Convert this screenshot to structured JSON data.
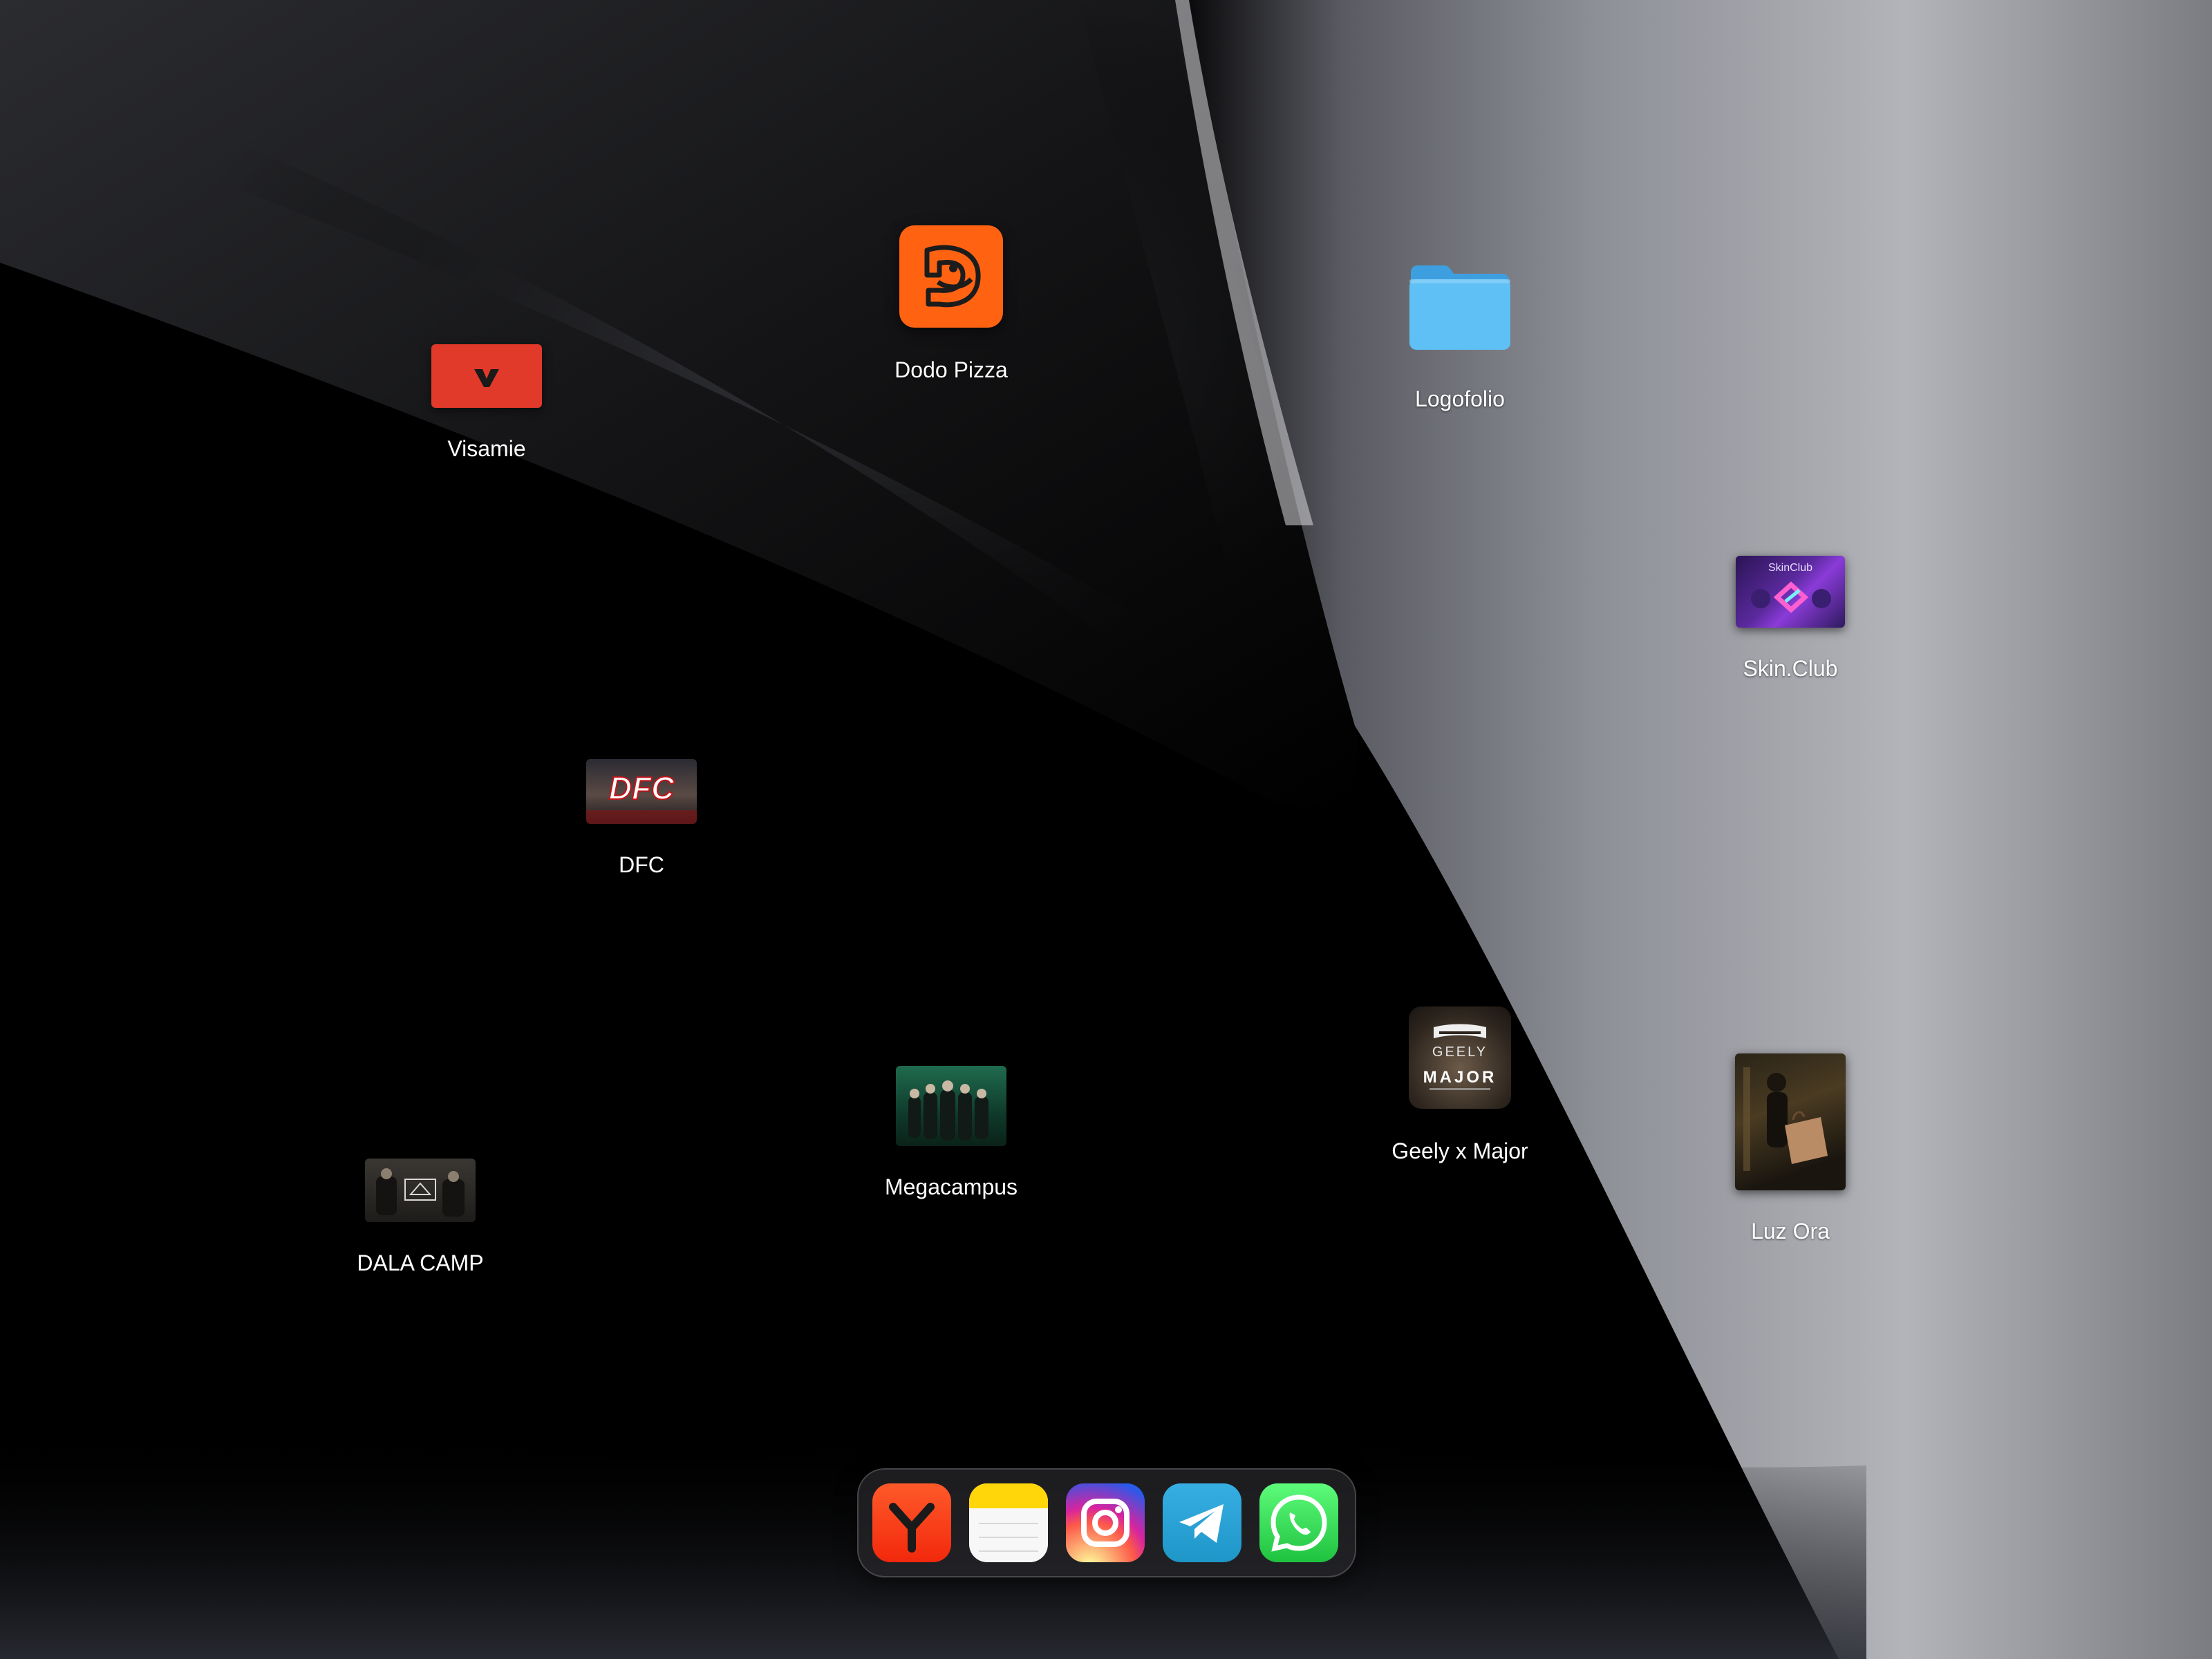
{
  "desktop": {
    "icons": [
      {
        "id": "visamie",
        "label": "Visamie",
        "icon": "visamie-logo-icon"
      },
      {
        "id": "dodo",
        "label": "Dodo Pizza",
        "icon": "dodo-pizza-logo-icon"
      },
      {
        "id": "logofolio",
        "label": "Logofolio",
        "icon": "folder-icon",
        "color": "#4fb7f2"
      },
      {
        "id": "skinclub",
        "label": "Skin.Club",
        "icon": "skin-club-thumbnail",
        "thumb_text": "SkinClub"
      },
      {
        "id": "dfc",
        "label": "DFC",
        "icon": "dfc-thumbnail",
        "thumb_text": "DFC"
      },
      {
        "id": "megacampus",
        "label": "Megacampus",
        "icon": "megacampus-thumbnail"
      },
      {
        "id": "geely",
        "label": "Geely x Major",
        "icon": "geely-major-logo-icon",
        "thumb_text_1": "GEELY",
        "thumb_text_2": "MAJOR"
      },
      {
        "id": "luzora",
        "label": "Luz Ora",
        "icon": "luz-ora-thumbnail"
      },
      {
        "id": "dala",
        "label": "DALA CAMP",
        "icon": "dala-camp-thumbnail"
      }
    ]
  },
  "dock": {
    "apps": [
      {
        "id": "yandex",
        "icon": "yandex-browser-icon",
        "color": "#f2280c"
      },
      {
        "id": "notes",
        "icon": "notes-icon",
        "color": "#ffd60a"
      },
      {
        "id": "instagram",
        "icon": "instagram-icon"
      },
      {
        "id": "telegram",
        "icon": "telegram-icon",
        "color": "#2aa3dc"
      },
      {
        "id": "whatsapp",
        "icon": "whatsapp-icon",
        "color": "#25d366"
      }
    ]
  }
}
